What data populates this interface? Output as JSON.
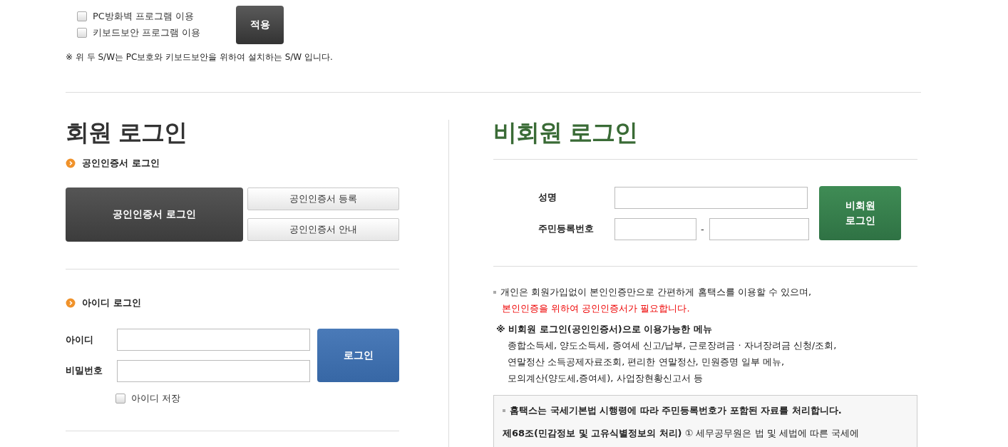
{
  "security": {
    "options": [
      {
        "label": "PC방화벽 프로그램 이용",
        "checked": false
      },
      {
        "label": "키보드보안 프로그램 이용",
        "checked": false
      }
    ],
    "apply_button": "적용",
    "note": "※ 위 두 S/W는 PC보호와 키보드보안을 위하여 설치하는 S/W 입니다."
  },
  "member_login": {
    "title": "회원 로그인",
    "cert_section": {
      "heading": "공인인증서 로그인",
      "login_button": "공인인증서 로그인",
      "register_button": "공인인증서 등록",
      "guide_button": "공인인증서 안내"
    },
    "id_section": {
      "heading": "아이디 로그인",
      "id_label": "아이디",
      "password_label": "비밀번호",
      "login_button": "로그인",
      "save_id": {
        "label": "아이디 저장",
        "checked": false
      }
    }
  },
  "guest_login": {
    "title": "비회원 로그인",
    "name_label": "성명",
    "rrn_label": "주민등록번호",
    "separator": "-",
    "login_button": "비회원 로그인",
    "intro": "개인은 회원가입없이 본인인증만으로 간편하게 홈택스를 이용할 수 있으며,",
    "warning": "본인인증을 위하여 공인인증서가 필요합니다.",
    "menus_title": "※ 비회원 로그인(공인인증서)으로 이용가능한 메뉴",
    "menu_lines": [
      "종합소득세, 양도소득세, 증여세 신고/납부, 근로장려금 · 자녀장려금 신청/조회,",
      "연말정산 소득공제자료조회, 편리한 연말정산, 민원증명 일부 메뉴,",
      "모의계산(양도세,증여세), 사업장현황신고서 등"
    ],
    "notice": {
      "heading": "홈택스는 국세기본법 시행령에 따라 주민등록번호가 포함된 자료를 처리합니다.",
      "text": "**제68조(민감정보 및 고유식별정보의 처리)** ① 세무공무원은 법 및 세법에 따른 국세에"
    }
  }
}
